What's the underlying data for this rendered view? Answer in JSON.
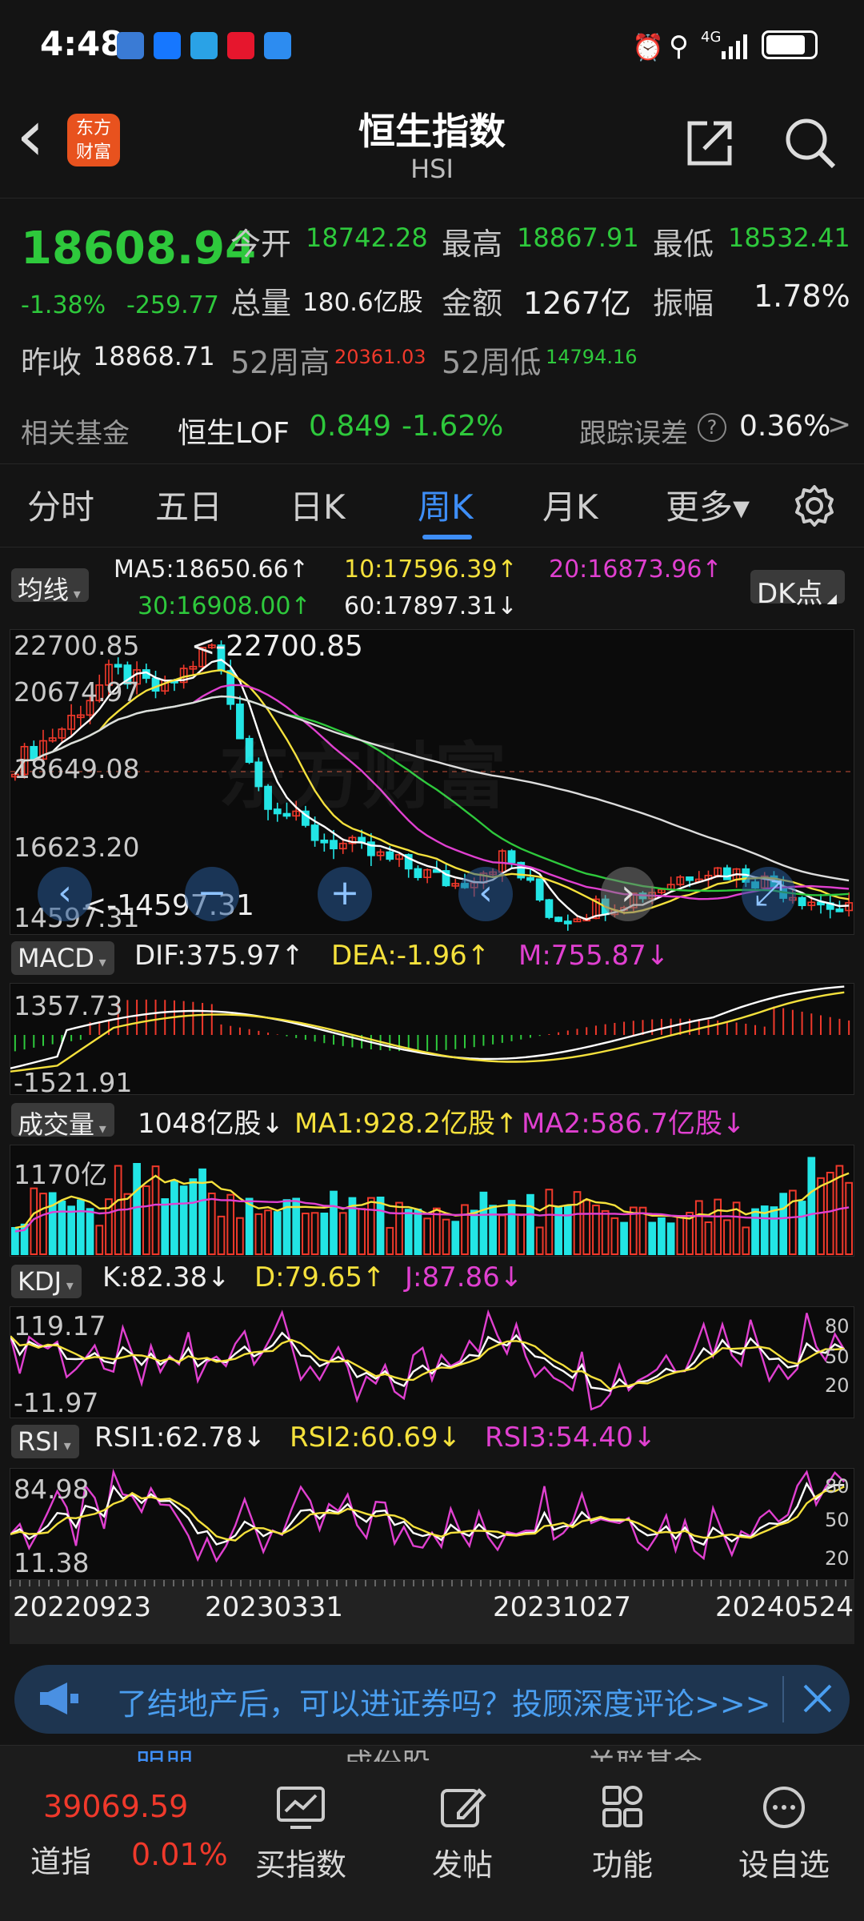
{
  "status": {
    "time": "4:48",
    "network": "4G"
  },
  "header": {
    "back": "‹",
    "logo_top": "东方",
    "logo_bottom": "财富",
    "title": "恒生指数",
    "subtitle": "HSI"
  },
  "quote": {
    "price": "18608.94",
    "pct": "-1.38%",
    "chg": "-259.77",
    "open_label": "今开",
    "open": "18742.28",
    "high_label": "最高",
    "high": "18867.91",
    "low_label": "最低",
    "low": "18532.41",
    "vol_label": "总量",
    "vol": "180.6亿股",
    "amt_label": "金额",
    "amt": "1267亿",
    "amp_label": "振幅",
    "amp": "1.78%",
    "prev_label": "昨收",
    "prev": "18868.71",
    "w52h_label": "52周高",
    "w52h": "20361.03",
    "w52l_label": "52周低",
    "w52l": "14794.16"
  },
  "fund": {
    "label": "相关基金",
    "name": "恒生LOF",
    "price": "0.849",
    "pct": "-1.62%",
    "err_label": "跟踪误差",
    "err_q": "?",
    "err": "0.36%",
    "arrow": ">"
  },
  "tabs": [
    "分时",
    "五日",
    "日K",
    "周K",
    "月K",
    "更多▾"
  ],
  "kline": {
    "ind": "均线",
    "ma5": "MA5:18650.66↑",
    "ma10": "10:17596.39↑",
    "ma20": "20:16873.96↑",
    "ma30": "30:16908.00↑",
    "ma60": "60:17897.31↓",
    "dk": "DK点",
    "y1": "22700.85",
    "y2": "20674.97",
    "y3": "18649.08",
    "y4": "16623.20",
    "y5": "14597.31",
    "hi": "<-22700.85",
    "lo": "<-14597.31",
    "watermark": "东方财富"
  },
  "macd": {
    "ind": "MACD",
    "dif": "DIF:375.97↑",
    "dea": "DEA:-1.96↑",
    "m": "M:755.87↓",
    "y1": "1357.73",
    "y2": "-1521.91"
  },
  "volume": {
    "ind": "成交量",
    "v": "1048亿股↓",
    "ma1": "MA1:928.2亿股↑",
    "ma2": "MA2:586.7亿股↓",
    "y1": "1170亿"
  },
  "kdj": {
    "ind": "KDJ",
    "k": "K:82.38↓",
    "d": "D:79.65↑",
    "j": "J:87.86↓",
    "y1": "119.17",
    "y2": "-11.97",
    "r1": "80",
    "r2": "50",
    "r3": "20"
  },
  "rsi": {
    "ind": "RSI",
    "r1": "RSI1:62.78↓",
    "r2": "RSI2:60.69↓",
    "r3": "RSI3:54.40↓",
    "y1": "84.98",
    "y2": "11.38",
    "l1": "80",
    "l2": "50",
    "l3": "20"
  },
  "dates": [
    "20220923",
    "20230331",
    "20231027",
    "20240524"
  ],
  "banner": {
    "text": "了结地产后，可以进证券吗？投顾深度评论>>>"
  },
  "bottom": {
    "idx_price": "39069.59",
    "idx_name": "道指",
    "idx_pct": "0.01%",
    "peek": [
      "明朋",
      "成份股",
      "关联基金"
    ],
    "nav": [
      "买指数",
      "发帖",
      "功能",
      "设自选"
    ]
  },
  "colors": {
    "up": "#f0392b",
    "down": "#2ec93c",
    "accent": "#3e8ef7"
  }
}
